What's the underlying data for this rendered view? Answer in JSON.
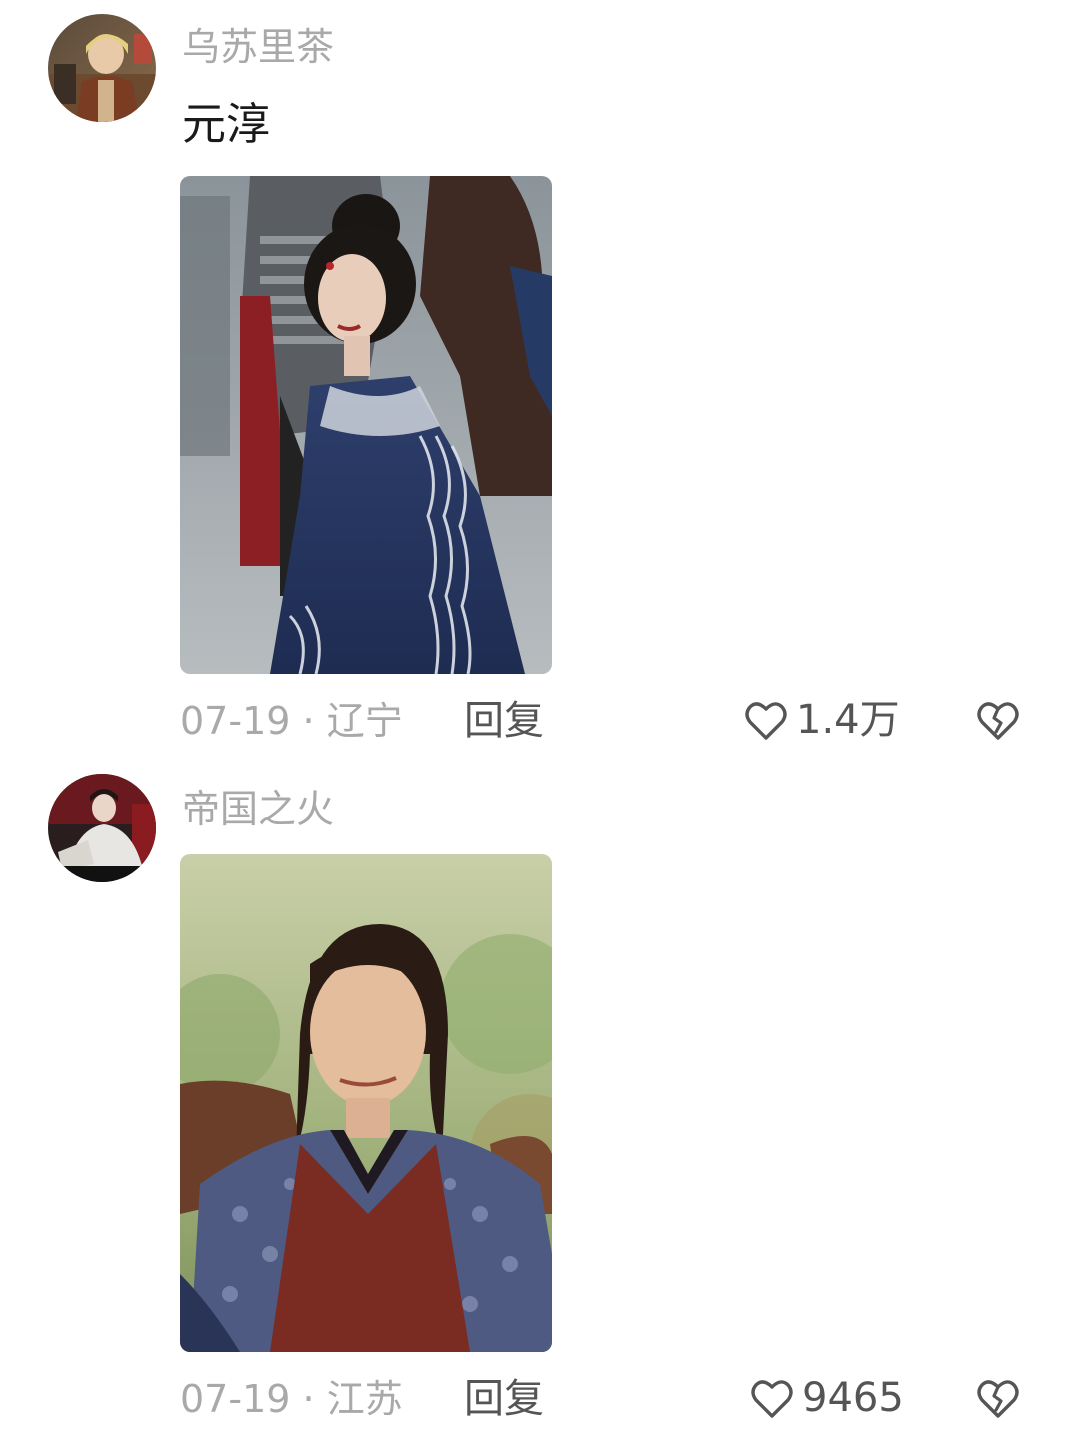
{
  "comments": [
    {
      "username": "乌苏里茶",
      "text": "元淳",
      "date": "07-19",
      "separator": "·",
      "location": "辽宁",
      "reply_label": "回复",
      "like_count": "1.4万",
      "icons": {
        "like": "heart-outline-icon",
        "dislike": "broken-heart-icon"
      }
    },
    {
      "username": "帝国之火",
      "date": "07-19",
      "separator": "·",
      "location": "江苏",
      "reply_label": "回复",
      "like_count": "9465",
      "icons": {
        "like": "heart-outline-icon",
        "dislike": "broken-heart-icon"
      }
    }
  ],
  "colors": {
    "meta_text": "#a9a9a9",
    "action_text": "#555555",
    "body_text": "#1a1a1a"
  }
}
